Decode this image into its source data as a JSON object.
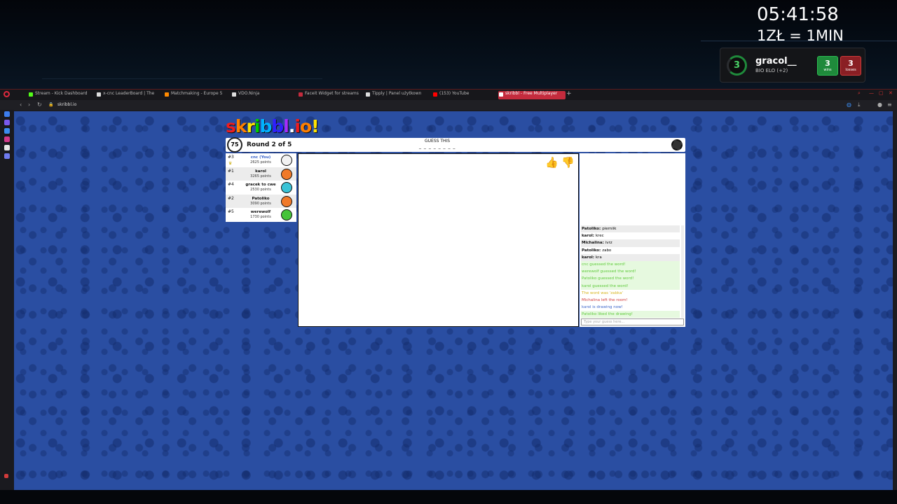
{
  "overlay": {
    "clock": "05:41:58",
    "rate": "1ZŁ = 1MIN",
    "faceit": {
      "level": "3",
      "username": "gracol__",
      "elo": "BIO ELO (+2)",
      "wins": "3",
      "wins_label": "wins",
      "losses": "3",
      "losses_label": "losses",
      "wins_color": "#1f8a3b",
      "losses_color": "#8a1f24"
    }
  },
  "browser": {
    "tabs": [
      {
        "label": "Stream - Kick Dashboard",
        "color": "#53fc18"
      },
      {
        "label": "x-cnc LeaderBoard | The",
        "color": "#dddddd"
      },
      {
        "label": "Matchmaking - Europe 5",
        "color": "#ff8a00"
      },
      {
        "label": "VDO.Ninja",
        "color": "#dddddd"
      },
      {
        "label": "Faceit Widget for streams",
        "color": "#c42b3d"
      },
      {
        "label": "Tipply | Panel użytkown",
        "color": "#dddddd"
      },
      {
        "label": "(153) YouTube",
        "color": "#ff0000"
      },
      {
        "label": "skribbl - Free Multiplayer",
        "color": "#ffffff"
      }
    ],
    "url": "skribbl.io"
  },
  "game": {
    "logo": [
      "s",
      "k",
      "r",
      "i",
      "b",
      "b",
      "l",
      ".",
      "i",
      "o",
      "!"
    ],
    "timer": "75",
    "round": "Round 2 of 5",
    "guess_label": "GUESS THIS",
    "hint": "_ _ _ _ _ _ _ _",
    "players": [
      {
        "rank": "#3",
        "name": "cnc (You)",
        "points": "2625 points",
        "avatar_color": "#f2f2f2",
        "you": true
      },
      {
        "rank": "#1",
        "name": "karol",
        "points": "3265 points",
        "avatar_color": "#f07a2a"
      },
      {
        "rank": "#4",
        "name": "gracek to cwe",
        "points": "2530 points",
        "avatar_color": "#3ac3d6"
      },
      {
        "rank": "#2",
        "name": "Patoliko",
        "points": "3090 points",
        "avatar_color": "#f07a2a"
      },
      {
        "rank": "#5",
        "name": "werewolf",
        "points": "1730 points",
        "avatar_color": "#46c43a"
      }
    ],
    "chat": [
      {
        "user": "Patoliko:",
        "text": "pierniik",
        "style": "even"
      },
      {
        "user": "karol:",
        "text": "krec",
        "style": ""
      },
      {
        "user": "Michalina:",
        "text": "ivrz",
        "style": "even"
      },
      {
        "user": "Patoliko:",
        "text": "zabo",
        "style": ""
      },
      {
        "user": "karol:",
        "text": "kra",
        "style": "even"
      },
      {
        "user": "",
        "text": "cnc guessed the word!",
        "style": "green"
      },
      {
        "user": "",
        "text": "werewolf guessed the word!",
        "style": "green"
      },
      {
        "user": "",
        "text": "Patoliko guessed the word!",
        "style": "green"
      },
      {
        "user": "",
        "text": "karol guessed the word!",
        "style": "green"
      },
      {
        "user": "",
        "text": "The word was 'zabka'",
        "style": "yellow"
      },
      {
        "user": "",
        "text": "Michalina left the room!",
        "style": "red"
      },
      {
        "user": "",
        "text": "karol is drawing now!",
        "style": "blue"
      },
      {
        "user": "",
        "text": "Patoliko liked the drawing!",
        "style": "green"
      }
    ],
    "chat_placeholder": "Type your guess here..."
  }
}
